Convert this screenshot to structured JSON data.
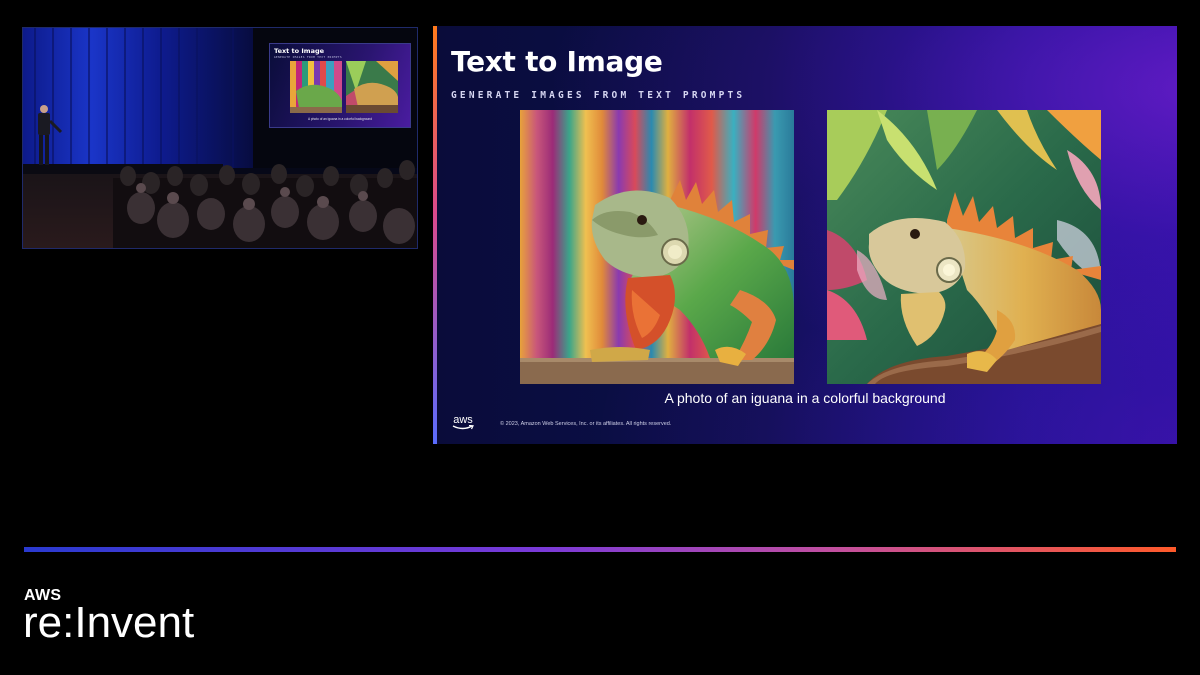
{
  "camera_feed": {
    "mini_slide": {
      "title": "Text to Image",
      "subtitle": "GENERATE IMAGES FROM TEXT PROMPTS",
      "caption": "A photo of an iguana in a colorful background"
    }
  },
  "slide": {
    "title": "Text to Image",
    "subtitle": "GENERATE IMAGES FROM TEXT PROMPTS",
    "caption": "A photo of an iguana in a colorful background",
    "logo_text": "aws",
    "copyright": "© 2023, Amazon Web Services, Inc. or its affiliates. All rights reserved."
  },
  "brand": {
    "aws": "AWS",
    "reinvent": "re:Invent"
  },
  "colors": {
    "background": "#000000",
    "slide_navy": "#0b0f4c",
    "slide_purple": "#5a1ab8",
    "accent_orange": "#ff7b1c",
    "accent_blue": "#2a3ad0"
  },
  "icons": {
    "aws_logo": "aws-smile-logo"
  }
}
